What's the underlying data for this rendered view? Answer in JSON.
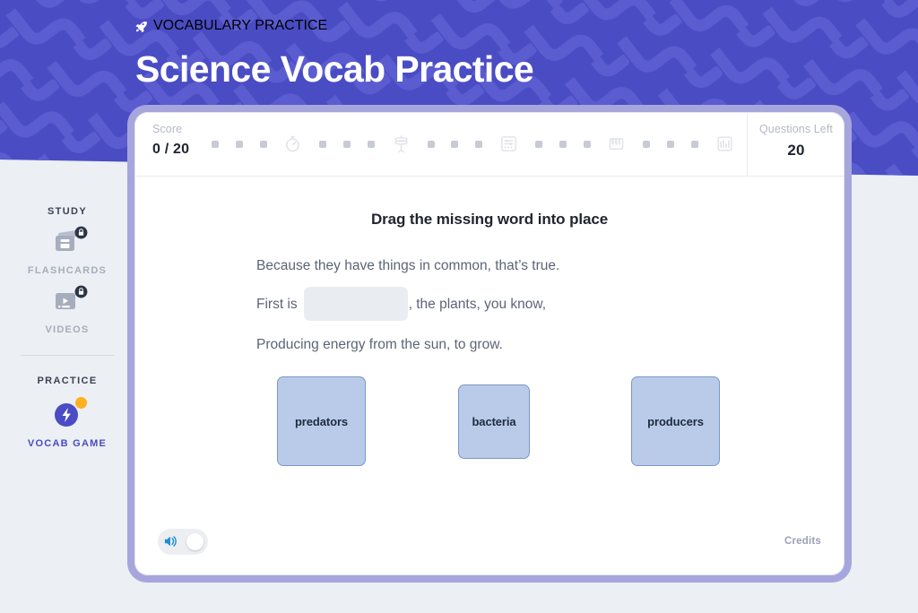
{
  "header": {
    "eyebrow": "VOCABULARY PRACTICE",
    "eyebrow_icon": "rocket-icon",
    "title": "Science Vocab Practice",
    "bg_color": "#4a4cc4",
    "pattern_color": "#5a5cd0"
  },
  "sidebar": {
    "sections": [
      {
        "title": "STUDY",
        "items": [
          {
            "label": "FLASHCARDS",
            "icon": "flashcards-icon",
            "locked": true,
            "active": false
          },
          {
            "label": "VIDEOS",
            "icon": "video-icon",
            "locked": true,
            "active": false
          }
        ]
      },
      {
        "title": "PRACTICE",
        "items": [
          {
            "label": "VOCAB GAME",
            "icon": "lightning-bolt-icon",
            "locked": false,
            "active": true,
            "badge": true
          }
        ]
      }
    ]
  },
  "status_bar": {
    "score_label": "Score",
    "score_value": "0 / 20",
    "questions_label": "Questions Left",
    "questions_value": "20",
    "milestones": [
      "dot",
      "dot",
      "dot",
      "stopwatch-icon",
      "dot",
      "dot",
      "dot",
      "cymbal-icon",
      "dot",
      "dot",
      "dot",
      "mixer-icon",
      "dot",
      "dot",
      "dot",
      "piano-icon",
      "dot",
      "dot",
      "dot",
      "equalizer-icon"
    ]
  },
  "question": {
    "prompt": "Drag the missing word into place",
    "lines": [
      {
        "before": "Because they have things in common, that’s true.",
        "blank": false,
        "after": ""
      },
      {
        "before": "First is",
        "blank": true,
        "after": ", the plants, you know,"
      },
      {
        "before": "Producing energy from the sun, to grow.",
        "blank": false,
        "after": ""
      }
    ],
    "blank_value": ""
  },
  "answers": {
    "cards": [
      {
        "label": "predators"
      },
      {
        "label": "bacteria"
      },
      {
        "label": "producers"
      }
    ],
    "card_fill": "#b9cbe9",
    "card_border": "#7b97c6"
  },
  "footer": {
    "sound_icon": "speaker-icon",
    "sound_on": true,
    "credits_label": "Credits"
  },
  "colors": {
    "page_bg": "#eceff3",
    "accent": "#4a4cc4",
    "card_border": "#a6a6dd",
    "badge": "#ffb020"
  }
}
